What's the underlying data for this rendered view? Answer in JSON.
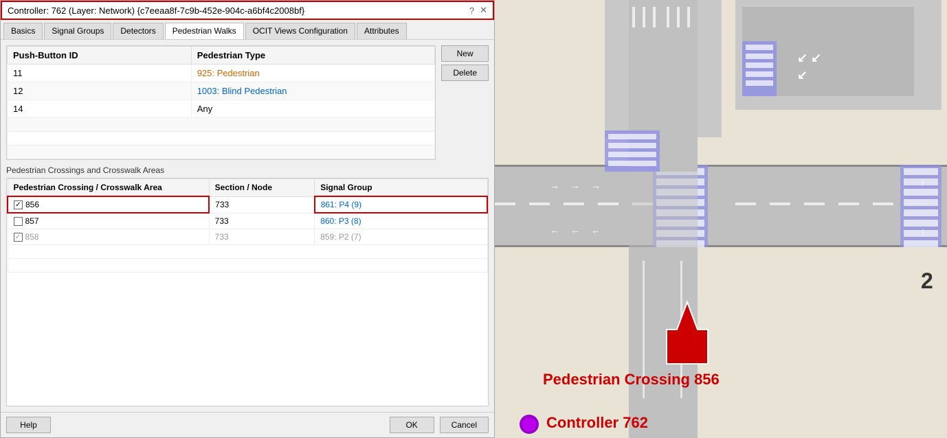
{
  "titleBar": {
    "text": "Controller: 762 (Layer: Network) {c7eeaa8f-7c9b-452e-904c-a6bf4c2008bf}",
    "helpIcon": "?",
    "closeIcon": "✕"
  },
  "tabs": [
    {
      "id": "basics",
      "label": "Basics",
      "active": false
    },
    {
      "id": "signal-groups",
      "label": "Signal Groups",
      "active": false
    },
    {
      "id": "detectors",
      "label": "Detectors",
      "active": false
    },
    {
      "id": "pedestrian-walks",
      "label": "Pedestrian Walks",
      "active": true
    },
    {
      "id": "ocit-views",
      "label": "OCIT Views Configuration",
      "active": false
    },
    {
      "id": "attributes",
      "label": "Attributes",
      "active": false
    }
  ],
  "pushButtonTable": {
    "col1Header": "Push-Button ID",
    "col2Header": "Pedestrian Type",
    "rows": [
      {
        "id": "11",
        "type": "925: Pedestrian",
        "typeClass": "link-orange"
      },
      {
        "id": "12",
        "type": "1003: Blind Pedestrian",
        "typeClass": "link-blue"
      },
      {
        "id": "14",
        "type": "Any",
        "typeClass": "plain"
      }
    ]
  },
  "actionButtons": {
    "new": "New",
    "delete": "Delete"
  },
  "crossingsSection": {
    "label": "Pedestrian Crossings and Crosswalk Areas",
    "col1Header": "Pedestrian Crossing / Crosswalk Area",
    "col2Header": "Section / Node",
    "col3Header": "Signal Group",
    "rows": [
      {
        "id": "856",
        "checked": true,
        "disabled": false,
        "highlighted": true,
        "section": "733",
        "signalGroup": "861: P4 (9)",
        "signalClass": "link-signal-blue"
      },
      {
        "id": "857",
        "checked": false,
        "disabled": false,
        "highlighted": false,
        "section": "733",
        "signalGroup": "860: P3 (8)",
        "signalClass": "link-signal-blue"
      },
      {
        "id": "858",
        "checked": true,
        "disabled": true,
        "highlighted": false,
        "section": "733",
        "signalGroup": "859: P2 (7)",
        "signalClass": "link-signal-blue-disabled"
      }
    ]
  },
  "bottomButtons": {
    "help": "Help",
    "ok": "OK",
    "cancel": "Cancel"
  },
  "mapAnnotations": {
    "crossingLabel": "Pedestrian Crossing 856",
    "controllerLabel": "Controller 762",
    "numberLabel": "2"
  }
}
